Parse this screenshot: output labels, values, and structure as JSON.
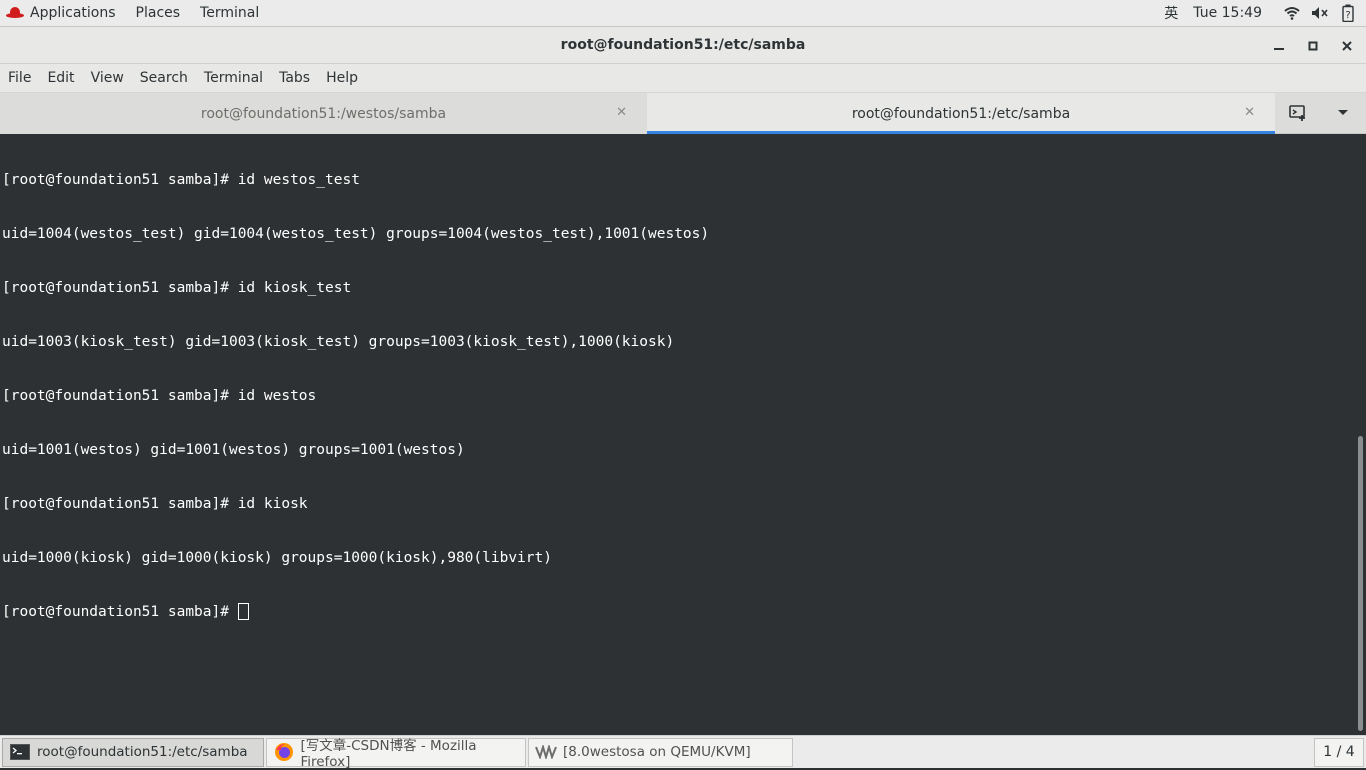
{
  "topbar": {
    "applications": "Applications",
    "places": "Places",
    "terminal": "Terminal",
    "ime": "英",
    "clock": "Tue 15:49"
  },
  "window": {
    "title": "root@foundation51:/etc/samba",
    "minimize": "—",
    "maximize": "□",
    "close": "✕"
  },
  "menubar": [
    "File",
    "Edit",
    "View",
    "Search",
    "Terminal",
    "Tabs",
    "Help"
  ],
  "tabs": [
    {
      "label": "root@foundation51:/westos/samba",
      "active": false
    },
    {
      "label": "root@foundation51:/etc/samba",
      "active": true
    }
  ],
  "tab_close": "✕",
  "terminal_lines": [
    "[root@foundation51 samba]# id westos_test",
    "uid=1004(westos_test) gid=1004(westos_test) groups=1004(westos_test),1001(westos)",
    "[root@foundation51 samba]# id kiosk_test",
    "uid=1003(kiosk_test) gid=1003(kiosk_test) groups=1003(kiosk_test),1000(kiosk)",
    "[root@foundation51 samba]# id westos",
    "uid=1001(westos) gid=1001(westos) groups=1001(westos)",
    "[root@foundation51 samba]# id kiosk",
    "uid=1000(kiosk) gid=1000(kiosk) groups=1000(kiosk),980(libvirt)"
  ],
  "prompt": "[root@foundation51 samba]# ",
  "taskbar": {
    "tasks": [
      {
        "label": "root@foundation51:/etc/samba",
        "icon": "terminal-icon"
      },
      {
        "label": "[写文章-CSDN博客 - Mozilla Firefox]",
        "icon": "firefox-icon"
      },
      {
        "label": "[8.0westosa on QEMU/KVM]",
        "icon": "virt-manager-icon"
      }
    ],
    "workspace": "1 / 4"
  },
  "colors": {
    "terminal_bg": "#2d3133",
    "terminal_fg": "#ffffff",
    "tab_accent": "#3584e4",
    "redhat": "#d01d1d"
  }
}
